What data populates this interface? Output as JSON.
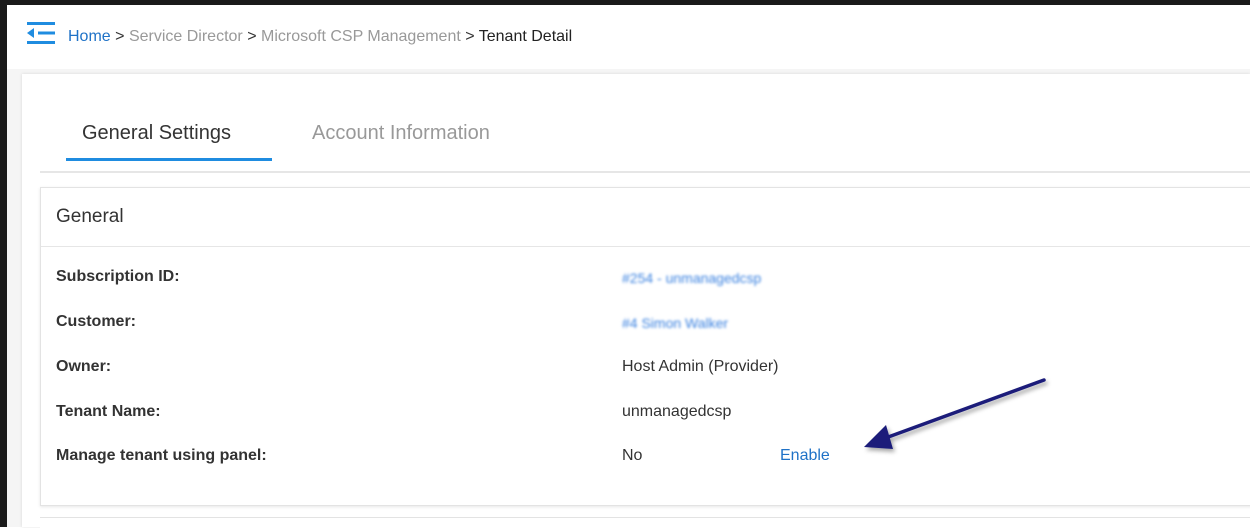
{
  "breadcrumb": {
    "home": "Home",
    "sep": ">",
    "service_director": "Service Director",
    "csp_management": "Microsoft CSP Management",
    "current": "Tenant Detail"
  },
  "tabs": [
    {
      "label": "General Settings",
      "active": true
    },
    {
      "label": "Account Information",
      "active": false
    }
  ],
  "general": {
    "title": "General",
    "rows": [
      {
        "label": "Subscription ID:",
        "value": "#254 - unmanagedcsp"
      },
      {
        "label": "Customer:",
        "value": "#4 Simon Walker"
      },
      {
        "label": "Owner:",
        "value": "Host Admin (Provider)"
      },
      {
        "label": "Tenant Name:",
        "value": "unmanagedcsp"
      },
      {
        "label": "Manage tenant using panel:",
        "value": "No",
        "action": "Enable"
      }
    ]
  },
  "colors": {
    "link_blue": "#1f72c7",
    "tab_underline": "#1f8ce0",
    "arrow": "#1a1f7a"
  },
  "icons": {
    "menu": "menu-collapse-icon",
    "annotation": "arrow-annotation"
  }
}
